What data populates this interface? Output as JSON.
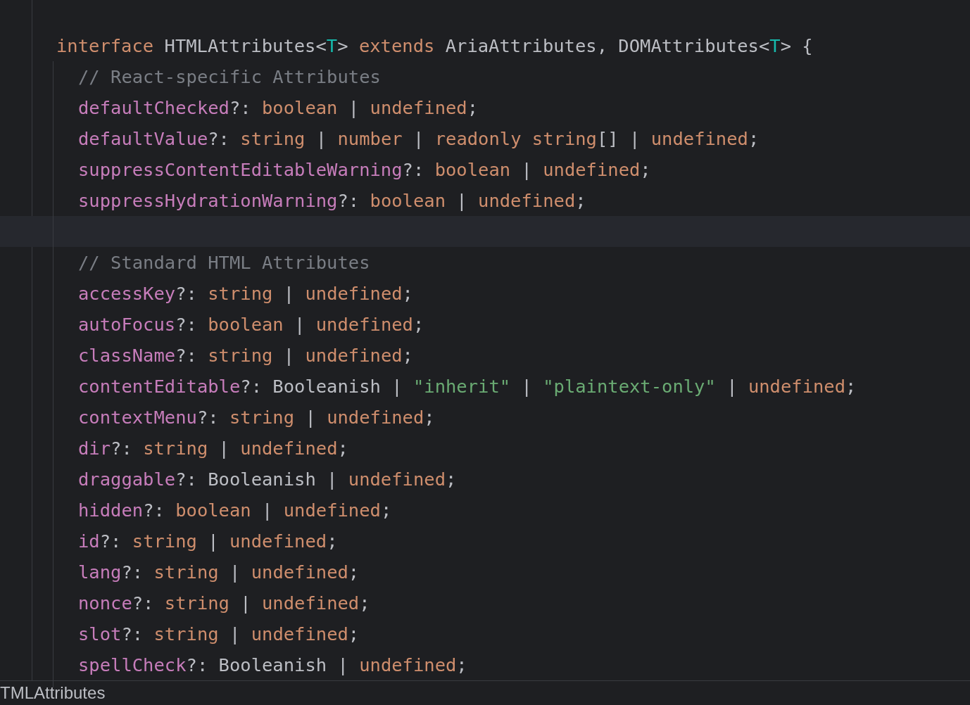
{
  "editor": {
    "code": [
      {
        "tokens": [
          {
            "kind": "kw",
            "text": "interface"
          },
          {
            "kind": "plain",
            "text": " HTMLAttributes<"
          },
          {
            "kind": "tparam",
            "text": "T"
          },
          {
            "kind": "plain",
            "text": "> "
          },
          {
            "kind": "kw",
            "text": "extends"
          },
          {
            "kind": "plain",
            "text": " AriaAttributes, DOMAttributes<"
          },
          {
            "kind": "tparam",
            "text": "T"
          },
          {
            "kind": "plain",
            "text": "> {"
          }
        ],
        "current": false,
        "children": [
          {
            "tokens": [
              {
                "kind": "comment",
                "text": "// React-specific Attributes"
              }
            ],
            "current": false
          },
          {
            "tokens": [
              {
                "kind": "prop",
                "text": "defaultChecked"
              },
              {
                "kind": "plain",
                "text": "?: "
              },
              {
                "kind": "kw",
                "text": "boolean"
              },
              {
                "kind": "plain",
                "text": " | "
              },
              {
                "kind": "kw",
                "text": "undefined"
              },
              {
                "kind": "plain",
                "text": ";"
              }
            ],
            "current": false
          },
          {
            "tokens": [
              {
                "kind": "prop",
                "text": "defaultValue"
              },
              {
                "kind": "plain",
                "text": "?: "
              },
              {
                "kind": "kw",
                "text": "string"
              },
              {
                "kind": "plain",
                "text": " | "
              },
              {
                "kind": "kw",
                "text": "number"
              },
              {
                "kind": "plain",
                "text": " | "
              },
              {
                "kind": "kw",
                "text": "readonly string"
              },
              {
                "kind": "plain",
                "text": "[] | "
              },
              {
                "kind": "kw",
                "text": "undefined"
              },
              {
                "kind": "plain",
                "text": ";"
              }
            ],
            "current": false
          },
          {
            "tokens": [
              {
                "kind": "prop",
                "text": "suppressContentEditableWarning"
              },
              {
                "kind": "plain",
                "text": "?: "
              },
              {
                "kind": "kw",
                "text": "boolean"
              },
              {
                "kind": "plain",
                "text": " | "
              },
              {
                "kind": "kw",
                "text": "undefined"
              },
              {
                "kind": "plain",
                "text": ";"
              }
            ],
            "current": false
          },
          {
            "tokens": [
              {
                "kind": "prop",
                "text": "suppressHydrationWarning"
              },
              {
                "kind": "plain",
                "text": "?: "
              },
              {
                "kind": "kw",
                "text": "boolean"
              },
              {
                "kind": "plain",
                "text": " | "
              },
              {
                "kind": "kw",
                "text": "undefined"
              },
              {
                "kind": "plain",
                "text": ";"
              }
            ],
            "current": false
          },
          {
            "current": true
          },
          {
            "tokens": [
              {
                "kind": "comment",
                "text": "// Standard HTML Attributes"
              }
            ],
            "current": false
          },
          {
            "tokens": [
              {
                "kind": "prop",
                "text": "accessKey"
              },
              {
                "kind": "plain",
                "text": "?: "
              },
              {
                "kind": "kw",
                "text": "string"
              },
              {
                "kind": "plain",
                "text": " | "
              },
              {
                "kind": "kw",
                "text": "undefined"
              },
              {
                "kind": "plain",
                "text": ";"
              }
            ],
            "current": false
          },
          {
            "tokens": [
              {
                "kind": "prop",
                "text": "autoFocus"
              },
              {
                "kind": "plain",
                "text": "?: "
              },
              {
                "kind": "kw",
                "text": "boolean"
              },
              {
                "kind": "plain",
                "text": " | "
              },
              {
                "kind": "kw",
                "text": "undefined"
              },
              {
                "kind": "plain",
                "text": ";"
              }
            ],
            "current": false
          },
          {
            "tokens": [
              {
                "kind": "prop",
                "text": "className"
              },
              {
                "kind": "plain",
                "text": "?: "
              },
              {
                "kind": "kw",
                "text": "string"
              },
              {
                "kind": "plain",
                "text": " | "
              },
              {
                "kind": "kw",
                "text": "undefined"
              },
              {
                "kind": "plain",
                "text": ";"
              }
            ],
            "current": false
          },
          {
            "tokens": [
              {
                "kind": "prop",
                "text": "contentEditable"
              },
              {
                "kind": "plain",
                "text": "?: Booleanish | "
              },
              {
                "kind": "str",
                "text": "\"inherit\""
              },
              {
                "kind": "plain",
                "text": " | "
              },
              {
                "kind": "str",
                "text": "\"plaintext-only\""
              },
              {
                "kind": "plain",
                "text": " | "
              },
              {
                "kind": "kw",
                "text": "undefined"
              },
              {
                "kind": "plain",
                "text": ";"
              }
            ],
            "current": false
          },
          {
            "tokens": [
              {
                "kind": "prop",
                "text": "contextMenu"
              },
              {
                "kind": "plain",
                "text": "?: "
              },
              {
                "kind": "kw",
                "text": "string"
              },
              {
                "kind": "plain",
                "text": " | "
              },
              {
                "kind": "kw",
                "text": "undefined"
              },
              {
                "kind": "plain",
                "text": ";"
              }
            ],
            "current": false
          },
          {
            "tokens": [
              {
                "kind": "prop",
                "text": "dir"
              },
              {
                "kind": "plain",
                "text": "?: "
              },
              {
                "kind": "kw",
                "text": "string"
              },
              {
                "kind": "plain",
                "text": " | "
              },
              {
                "kind": "kw",
                "text": "undefined"
              },
              {
                "kind": "plain",
                "text": ";"
              }
            ],
            "current": false
          },
          {
            "tokens": [
              {
                "kind": "prop",
                "text": "draggable"
              },
              {
                "kind": "plain",
                "text": "?: Booleanish | "
              },
              {
                "kind": "kw",
                "text": "undefined"
              },
              {
                "kind": "plain",
                "text": ";"
              }
            ],
            "current": false
          },
          {
            "tokens": [
              {
                "kind": "prop",
                "text": "hidden"
              },
              {
                "kind": "plain",
                "text": "?: "
              },
              {
                "kind": "kw",
                "text": "boolean"
              },
              {
                "kind": "plain",
                "text": " | "
              },
              {
                "kind": "kw",
                "text": "undefined"
              },
              {
                "kind": "plain",
                "text": ";"
              }
            ],
            "current": false
          },
          {
            "tokens": [
              {
                "kind": "prop",
                "text": "id"
              },
              {
                "kind": "plain",
                "text": "?: "
              },
              {
                "kind": "kw",
                "text": "string"
              },
              {
                "kind": "plain",
                "text": " | "
              },
              {
                "kind": "kw",
                "text": "undefined"
              },
              {
                "kind": "plain",
                "text": ";"
              }
            ],
            "current": false
          },
          {
            "tokens": [
              {
                "kind": "prop",
                "text": "lang"
              },
              {
                "kind": "plain",
                "text": "?: "
              },
              {
                "kind": "kw",
                "text": "string"
              },
              {
                "kind": "plain",
                "text": " | "
              },
              {
                "kind": "kw",
                "text": "undefined"
              },
              {
                "kind": "plain",
                "text": ";"
              }
            ],
            "current": false
          },
          {
            "tokens": [
              {
                "kind": "prop",
                "text": "nonce"
              },
              {
                "kind": "plain",
                "text": "?: "
              },
              {
                "kind": "kw",
                "text": "string"
              },
              {
                "kind": "plain",
                "text": " | "
              },
              {
                "kind": "kw",
                "text": "undefined"
              },
              {
                "kind": "plain",
                "text": ";"
              }
            ],
            "current": false
          },
          {
            "tokens": [
              {
                "kind": "prop",
                "text": "slot"
              },
              {
                "kind": "plain",
                "text": "?: "
              },
              {
                "kind": "kw",
                "text": "string"
              },
              {
                "kind": "plain",
                "text": " | "
              },
              {
                "kind": "kw",
                "text": "undefined"
              },
              {
                "kind": "plain",
                "text": ";"
              }
            ],
            "current": false
          },
          {
            "tokens": [
              {
                "kind": "prop",
                "text": "spellCheck"
              },
              {
                "kind": "plain",
                "text": "?: Booleanish | "
              },
              {
                "kind": "kw",
                "text": "undefined"
              },
              {
                "kind": "plain",
                "text": ";"
              }
            ],
            "current": false
          }
        ]
      }
    ]
  },
  "breadcrumb": "TMLAttributes"
}
